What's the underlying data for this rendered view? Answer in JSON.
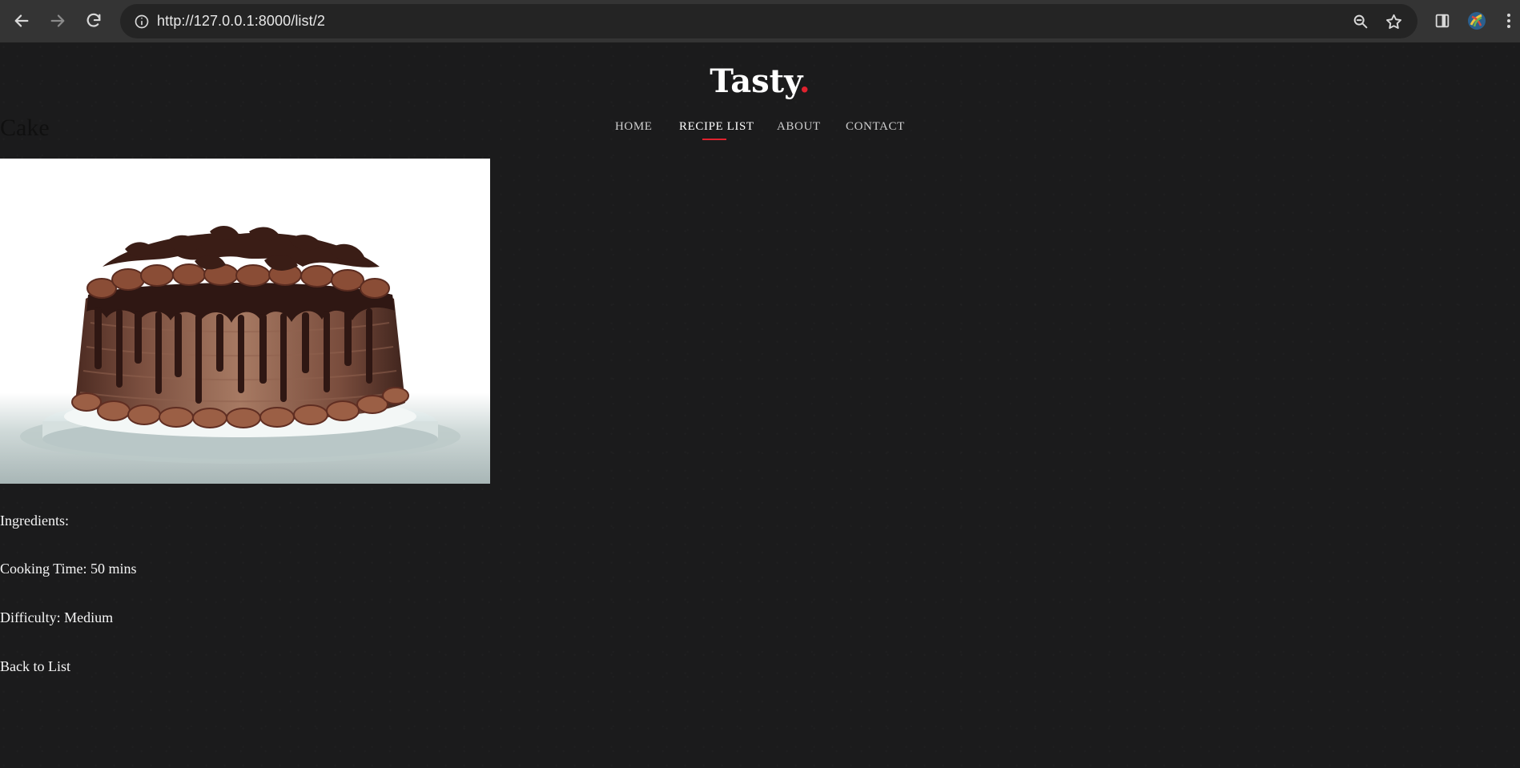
{
  "browser": {
    "url": "http://127.0.0.1:8000/list/2",
    "back_icon": "arrow-left-icon",
    "forward_icon": "arrow-right-icon",
    "reload_icon": "reload-icon",
    "site_info_icon": "info-icon",
    "zoom_icon": "zoom-icon",
    "bookmark_icon": "star-icon",
    "side_panel_icon": "side-panel-icon",
    "profile_icon": "profile-avatar-icon",
    "menu_icon": "more-vertical-icon"
  },
  "site": {
    "brand": "Tasty",
    "brand_dot": ".",
    "accent_color": "#e0222e",
    "background_color": "#1b1b1c"
  },
  "navigation": {
    "items": [
      {
        "label": "HOME",
        "active": false
      },
      {
        "label": "RECIPE LIST",
        "active": true
      },
      {
        "label": "ABOUT",
        "active": false
      },
      {
        "label": "CONTACT",
        "active": false
      }
    ]
  },
  "recipe": {
    "title": "Cake",
    "image_subject": "chocolate drip cake on a white cake stand",
    "ingredients_label": "Ingredients:",
    "cooking_time": "Cooking Time: 50 mins",
    "difficulty": "Difficulty: Medium",
    "back_link": "Back to List"
  }
}
